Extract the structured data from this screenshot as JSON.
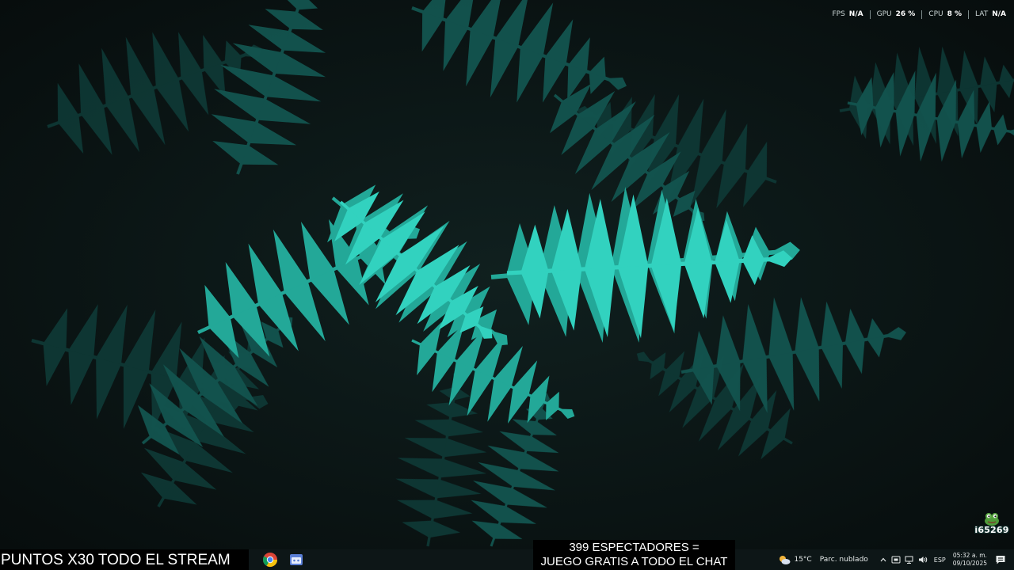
{
  "perf_overlay": {
    "stats": [
      {
        "label": "FPS",
        "value": "N/A"
      },
      {
        "label": "GPU",
        "value": "26 %"
      },
      {
        "label": "CPU",
        "value": "8 %"
      },
      {
        "label": "LAT",
        "value": "N/A"
      }
    ]
  },
  "channel_badge": {
    "text": "i65269",
    "icon": "frog-emote-icon"
  },
  "stream_overlay": {
    "ticker_text": "PUNTOS X30 TODO EL STREAM",
    "viewer_line1": "399 ESPECTADORES =",
    "viewer_line2": "JUEGO GRATIS A TODO EL CHAT"
  },
  "taskbar": {
    "pinned_apps": [
      {
        "name": "chrome",
        "icon": "chrome-icon"
      },
      {
        "name": "app",
        "icon": "app-window-icon"
      }
    ],
    "weather": {
      "temp": "15°C",
      "condition": "Parc. nublado",
      "icon": "partly-cloudy-icon"
    },
    "tray_icons": [
      "chevron-up-icon",
      "tray-app-icon",
      "network-icon",
      "volume-icon"
    ],
    "language": "ESP",
    "time": "05:32 a. m.",
    "date": "09/10/2025",
    "notification_icon": "notification-icon"
  },
  "colors": {
    "wallpaper_base": "#0b1414",
    "fern_bright": "#2fc8b6",
    "fern_dim": "#0f4a46",
    "taskbar_bg": "#0d1617"
  }
}
